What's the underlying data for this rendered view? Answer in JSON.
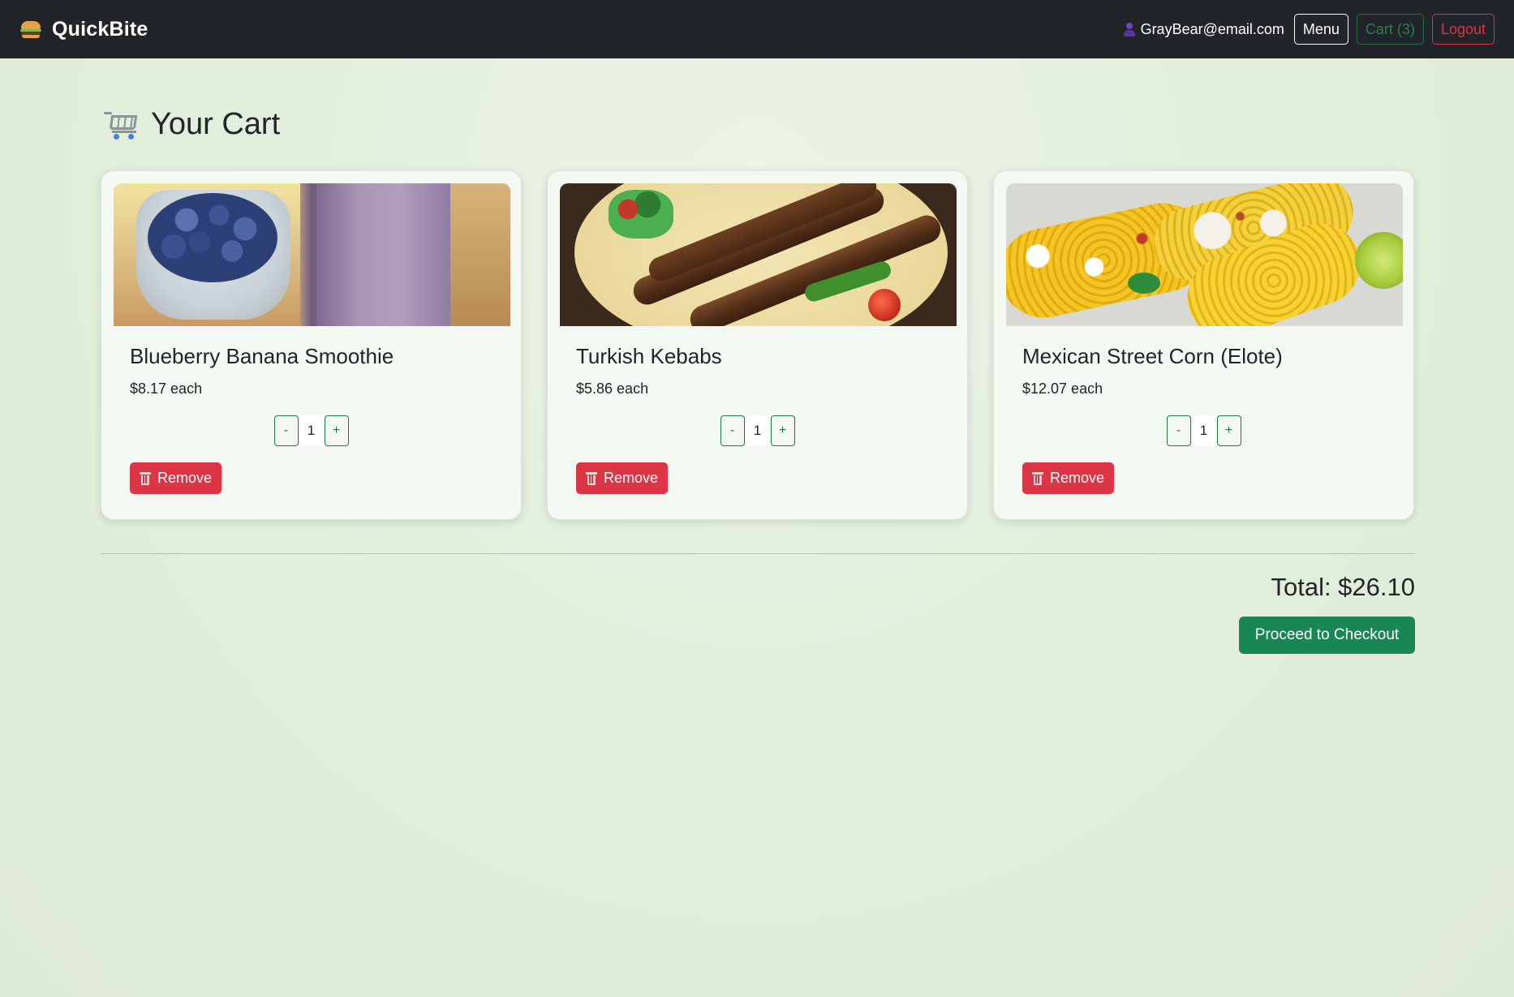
{
  "navbar": {
    "brand": "QuickBite",
    "user_email": "GrayBear@email.com",
    "menu_label": "Menu",
    "cart_label": "Cart (3)",
    "logout_label": "Logout"
  },
  "page": {
    "title": "Your Cart"
  },
  "cart": {
    "items": [
      {
        "name": "Blueberry Banana Smoothie",
        "price": "$8.17 each",
        "quantity": "1",
        "image": "smoothie"
      },
      {
        "name": "Turkish Kebabs",
        "price": "$5.86 each",
        "quantity": "1",
        "image": "kebabs"
      },
      {
        "name": "Mexican Street Corn (Elote)",
        "price": "$12.07 each",
        "quantity": "1",
        "image": "corn"
      }
    ],
    "decrement_label": "-",
    "increment_label": "+",
    "remove_label": "Remove",
    "total": "Total: $26.10",
    "checkout_label": "Proceed to Checkout"
  },
  "colors": {
    "navbar_bg": "#212529",
    "remove": "#dc3545",
    "checkout": "#198754",
    "page_bg": "#e3eedc"
  },
  "icons": {
    "brand": "burger-icon",
    "user": "user-icon",
    "title": "shopping-cart-icon",
    "remove": "trash-icon"
  }
}
